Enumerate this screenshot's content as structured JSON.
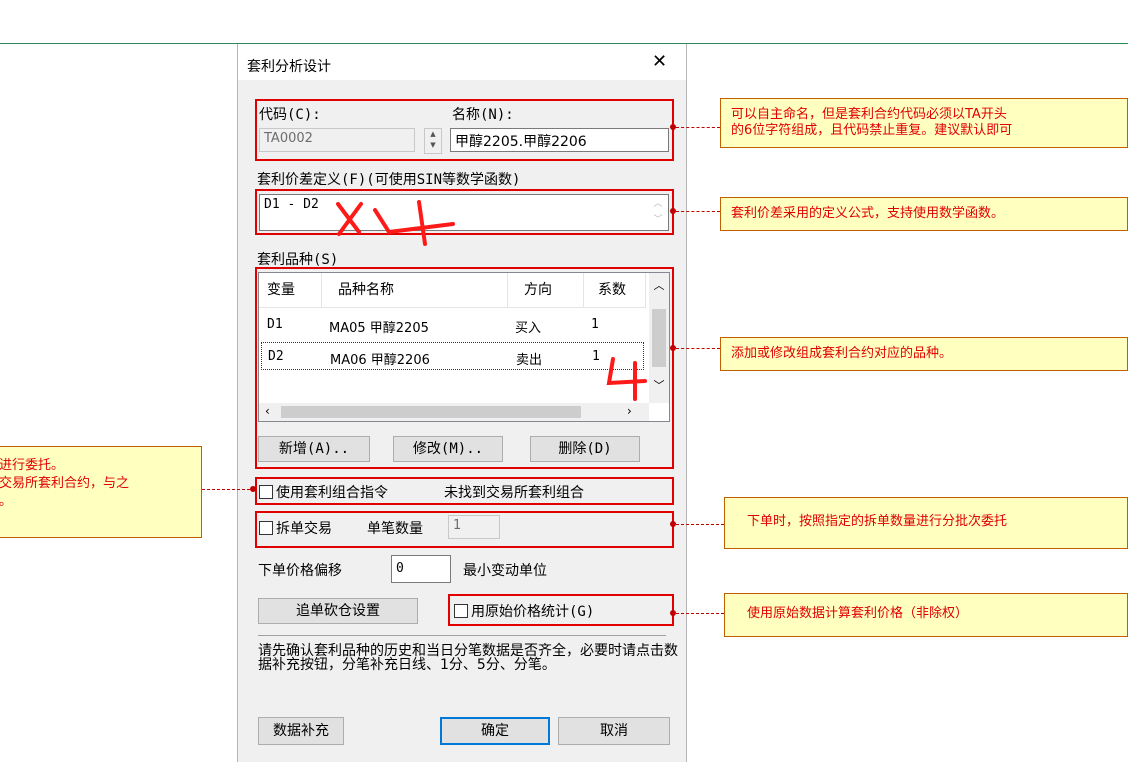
{
  "dialog": {
    "title": "套利分析设计",
    "code_label": "代码(C):",
    "code_value": "TA0002",
    "name_label": "名称(N):",
    "name_value": "甲醇2205.甲醇2206",
    "formula_label": "套利价差定义(F)(可使用SIN等数学函数)",
    "formula_value": "D1 - D2",
    "variety_label": "套利品种(S)",
    "table": {
      "columns": [
        "变量",
        "品种名称",
        "方向",
        "系数"
      ],
      "rows": [
        {
          "var": "D1",
          "name": "MA05 甲醇2205",
          "dir": "买入",
          "coef": "1"
        },
        {
          "var": "D2",
          "name": "MA06 甲醇2206",
          "dir": "卖出",
          "coef": "1"
        }
      ]
    },
    "buttons": {
      "add": "新增(A)..",
      "modify": "修改(M)..",
      "delete": "删除(D)"
    },
    "combo_order_label": "使用套利组合指令",
    "combo_order_status": "未找到交易所套利组合",
    "split_trade_label": "拆单交易",
    "single_qty_label": "单笔数量",
    "single_qty_value": "1",
    "price_offset_label": "下单价格偏移",
    "price_offset_value": "0",
    "min_tick_label": "最小变动单位",
    "chase_button": "追单砍仓设置",
    "raw_price_label": "用原始价格统计(G)",
    "notice": "请先确认套利品种的历史和当日分笔数据是否齐全，必要时请点击数据补充按钮，分笔补充日线、1分、5分、分笔。",
    "data_fill_button": "数据补充",
    "ok_button": "确定",
    "cancel_button": "取消"
  },
  "annotations": {
    "code_note_line1": "可以自主命名，但是套利合约代码必须以TA开头",
    "code_note_line2": "的6位字符组成，且代码禁止重复。建议默认即可",
    "formula_note": "套利价差采用的定义公式，支持使用数学函数。",
    "variety_note": "添加或修改组成套利合约对应的品种。",
    "combo_note_line1": "进行委托。",
    "combo_note_line2": "交易所套利合约，与之",
    "combo_note_line3": "。",
    "split_note": "下单时，按照指定的拆单数量进行分批次委托",
    "raw_price_note": "使用原始数据计算套利价格（非除权）"
  },
  "colors": {
    "highlight": "#e10000",
    "annotation_bg": "#ffffc0",
    "annotation_text": "#e00000",
    "default_button_border": "#0078d7"
  }
}
